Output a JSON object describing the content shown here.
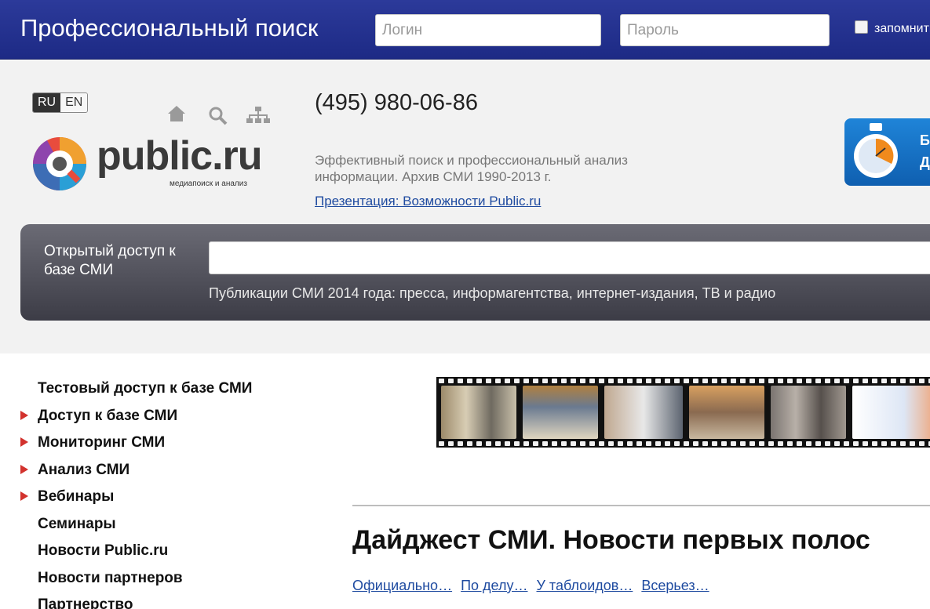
{
  "topbar": {
    "title": "Профессиональный поиск",
    "login_placeholder": "Логин",
    "password_placeholder": "Пароль",
    "remember_label": "запомнить"
  },
  "lang": {
    "ru": "RU",
    "en": "EN"
  },
  "logo": {
    "name": "public.ru",
    "tagline": "медиапоиск и анализ"
  },
  "contact": {
    "phone": "(495) 980-06-86"
  },
  "description": "Эффективный поиск и профессиональный анализ информации. Архив СМИ 1990-2013 г.",
  "presentation_link": "Презентация: Возможности Public.ru",
  "promo": {
    "letters": [
      "Б",
      "Д"
    ]
  },
  "search": {
    "label": "Открытый доступ к базе СМИ",
    "value": "",
    "hint": "Публикации СМИ 2014 года: пресса, информагентства, интернет-издания, ТВ и радио"
  },
  "menu": {
    "items": [
      {
        "label": "Тестовый доступ к базе СМИ",
        "arrow": false
      },
      {
        "label": "Доступ к базе СМИ",
        "arrow": true
      },
      {
        "label": "Мониторинг СМИ",
        "arrow": true
      },
      {
        "label": "Анализ СМИ",
        "arrow": true
      },
      {
        "label": "Вебинары",
        "arrow": true
      },
      {
        "label": "Семинары",
        "arrow": false
      },
      {
        "label": "Новости Public.ru",
        "arrow": false
      },
      {
        "label": "Новости партнеров",
        "arrow": false
      },
      {
        "label": "Партнерство",
        "arrow": false
      }
    ]
  },
  "digest": {
    "title": "Дайджест СМИ. Новости первых полос",
    "tabs": [
      "Официально…",
      "По делу…",
      "У таблоидов…",
      "Всерьез…"
    ]
  },
  "colors": {
    "topbar": "#22308f",
    "accent_arrow": "#d2322d",
    "link": "#1f4ba0"
  }
}
